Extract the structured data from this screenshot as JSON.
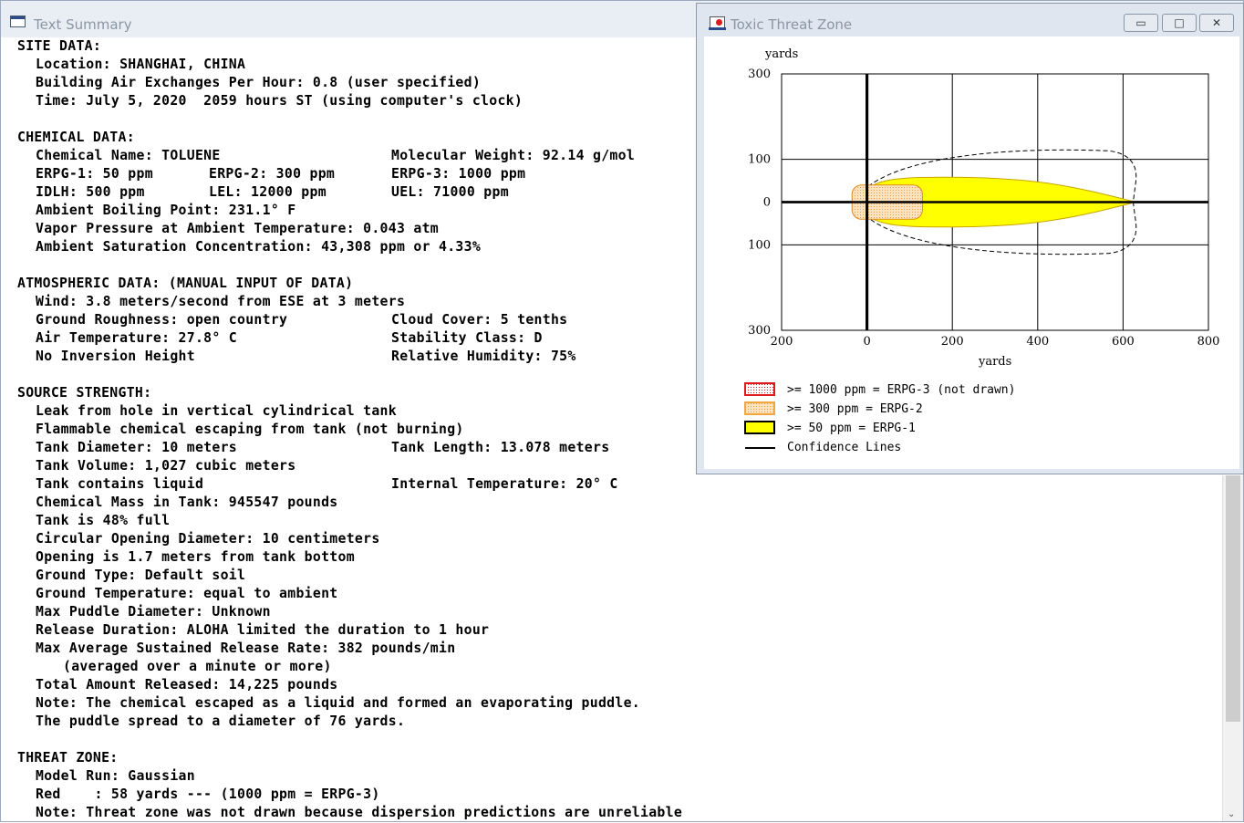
{
  "text_summary": {
    "title": "Text Summary",
    "lines": [
      {
        "type": "heading",
        "text": "SITE DATA:"
      },
      {
        "type": "line",
        "text": "Location: SHANGHAI, CHINA"
      },
      {
        "type": "line",
        "text": "Building Air Exchanges Per Hour: 0.8 (user specified)"
      },
      {
        "type": "line",
        "text": "Time: July 5, 2020  2059 hours ST (using computer's clock)"
      },
      {
        "type": "blank",
        "text": ""
      },
      {
        "type": "heading",
        "text": "CHEMICAL DATA:"
      },
      {
        "type": "two",
        "a": "Chemical Name: TOLUENE",
        "b": "Molecular Weight: 92.14 g/mol"
      },
      {
        "type": "three",
        "a": "ERPG-1: 50 ppm",
        "m": "ERPG-2: 300 ppm",
        "b": "ERPG-3: 1000 ppm"
      },
      {
        "type": "three",
        "a": "IDLH: 500 ppm",
        "m": "LEL: 12000 ppm",
        "b": "UEL: 71000 ppm"
      },
      {
        "type": "line",
        "text": "Ambient Boiling Point: 231.1° F"
      },
      {
        "type": "line",
        "text": "Vapor Pressure at Ambient Temperature: 0.043 atm"
      },
      {
        "type": "line",
        "text": "Ambient Saturation Concentration: 43,308 ppm or 4.33%"
      },
      {
        "type": "blank",
        "text": ""
      },
      {
        "type": "heading",
        "text": "ATMOSPHERIC DATA: (MANUAL INPUT OF DATA)"
      },
      {
        "type": "line",
        "text": "Wind: 3.8 meters/second from ESE at 3 meters"
      },
      {
        "type": "two",
        "a": "Ground Roughness: open country",
        "b": "Cloud Cover: 5 tenths"
      },
      {
        "type": "two",
        "a": "Air Temperature: 27.8° C",
        "b": "Stability Class: D"
      },
      {
        "type": "two",
        "a": "No Inversion Height",
        "b": "Relative Humidity: 75%"
      },
      {
        "type": "blank",
        "text": ""
      },
      {
        "type": "heading",
        "text": "SOURCE STRENGTH:"
      },
      {
        "type": "line",
        "text": "Leak from hole in vertical cylindrical tank"
      },
      {
        "type": "line",
        "text": "Flammable chemical escaping from tank (not burning)"
      },
      {
        "type": "two",
        "a": "Tank Diameter: 10 meters",
        "b": "Tank Length: 13.078 meters"
      },
      {
        "type": "line",
        "text": "Tank Volume: 1,027 cubic meters"
      },
      {
        "type": "two",
        "a": "Tank contains liquid",
        "b": "Internal Temperature: 20° C"
      },
      {
        "type": "line",
        "text": "Chemical Mass in Tank: 945547 pounds"
      },
      {
        "type": "line",
        "text": "Tank is 48% full"
      },
      {
        "type": "line",
        "text": "Circular Opening Diameter: 10 centimeters"
      },
      {
        "type": "line",
        "text": "Opening is 1.7 meters from tank bottom"
      },
      {
        "type": "line",
        "text": "Ground Type: Default soil"
      },
      {
        "type": "line",
        "text": "Ground Temperature: equal to ambient"
      },
      {
        "type": "line",
        "text": "Max Puddle Diameter: Unknown"
      },
      {
        "type": "line",
        "text": "Release Duration: ALOHA limited the duration to 1 hour"
      },
      {
        "type": "line",
        "text": "Max Average Sustained Release Rate: 382 pounds/min"
      },
      {
        "type": "line2",
        "text": "(averaged over a minute or more)"
      },
      {
        "type": "line",
        "text": "Total Amount Released: 14,225 pounds"
      },
      {
        "type": "line",
        "text": "Note: The chemical escaped as a liquid and formed an evaporating puddle."
      },
      {
        "type": "line",
        "text": "The puddle spread to a diameter of 76 yards."
      },
      {
        "type": "blank",
        "text": ""
      },
      {
        "type": "heading",
        "text": "THREAT ZONE:"
      },
      {
        "type": "line",
        "text": "Model Run: Gaussian"
      },
      {
        "type": "line",
        "text": "Red    : 58 yards --- (1000 ppm = ERPG-3)"
      },
      {
        "type": "line",
        "text": "Note: Threat zone was not drawn because dispersion predictions are unreliable"
      }
    ]
  },
  "threat_window": {
    "title": "Toxic Threat Zone",
    "buttons": {
      "minimize": "▭",
      "maximize": "□",
      "close": "✕"
    },
    "chart_data": {
      "type": "area",
      "y_unit_label": "yards",
      "x_unit_label": "yards",
      "xlim": [
        -200,
        800
      ],
      "ylim": [
        -300,
        300
      ],
      "x_ticks": [
        {
          "v": -200,
          "label": "200"
        },
        {
          "v": 0,
          "label": "0"
        },
        {
          "v": 200,
          "label": "200"
        },
        {
          "v": 400,
          "label": "400"
        },
        {
          "v": 600,
          "label": "600"
        },
        {
          "v": 800,
          "label": "800"
        }
      ],
      "y_ticks": [
        {
          "v": 300,
          "label": "300"
        },
        {
          "v": 100,
          "label": "100"
        },
        {
          "v": 0,
          "label": "0"
        },
        {
          "v": -100,
          "label": "100"
        },
        {
          "v": -300,
          "label": "300"
        }
      ],
      "grid": true,
      "zones": [
        {
          "name": "ERPG-1",
          "threshold_ppm": 50,
          "fill": "#ffff00",
          "stroke": "#c8a400",
          "x_start": -10,
          "x_end": 630,
          "half_width": 58
        },
        {
          "name": "ERPG-2",
          "threshold_ppm": 300,
          "fill": "#fcd8a0",
          "stroke": "#e08a20",
          "x_start": -35,
          "x_end": 130,
          "half_width": 40
        }
      ],
      "confidence_line": {
        "x_start": -10,
        "x_end": 630,
        "half_width": 120
      },
      "legend": [
        {
          "label": ">= 1000 ppm = ERPG-3 (not drawn)",
          "swatch": "red-dotted"
        },
        {
          "label": ">= 300 ppm = ERPG-2",
          "swatch": "orange"
        },
        {
          "label": ">= 50 ppm = ERPG-1",
          "swatch": "yellow"
        },
        {
          "label": "Confidence Lines",
          "swatch": "line"
        }
      ],
      "colors": {
        "erpg3": "#e0191c",
        "erpg2": "#f4a640",
        "erpg1": "#ffff00",
        "line": "#000000"
      }
    }
  }
}
